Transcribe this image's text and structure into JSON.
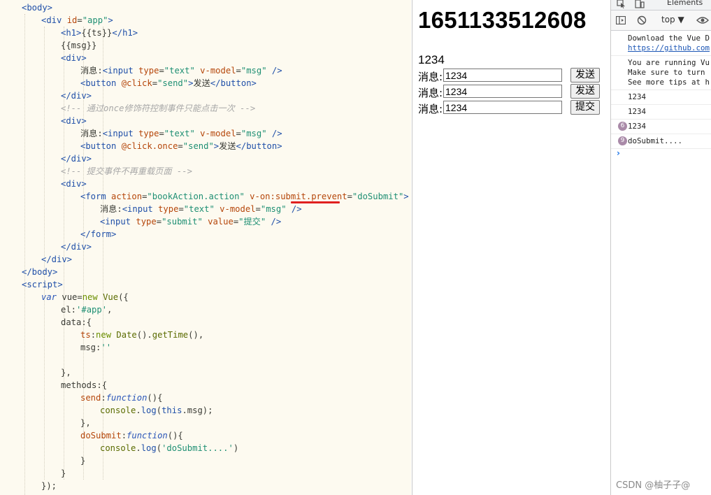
{
  "editor": {
    "lines": [
      {
        "indent": 1,
        "parts": [
          [
            "tag",
            "<body>"
          ]
        ]
      },
      {
        "indent": 2,
        "parts": [
          [
            "tag",
            "<div "
          ],
          [
            "attr",
            "id"
          ],
          [
            "punct",
            "="
          ],
          [
            "val",
            "\"app\""
          ],
          [
            "tag",
            ">"
          ]
        ]
      },
      {
        "indent": 3,
        "parts": [
          [
            "tag",
            "<h1>"
          ],
          [
            "txt",
            "{{ts}}"
          ],
          [
            "tag",
            "</h1>"
          ]
        ]
      },
      {
        "indent": 3,
        "parts": [
          [
            "txt",
            "{{msg}}"
          ]
        ]
      },
      {
        "indent": 3,
        "parts": [
          [
            "tag",
            "<div>"
          ]
        ]
      },
      {
        "indent": 4,
        "parts": [
          [
            "txt",
            "消息:"
          ],
          [
            "tag",
            "<input "
          ],
          [
            "attr",
            "type"
          ],
          [
            "punct",
            "="
          ],
          [
            "val",
            "\"text\""
          ],
          [
            "attr",
            " v-model"
          ],
          [
            "punct",
            "="
          ],
          [
            "val",
            "\"msg\""
          ],
          [
            "tag",
            " />"
          ]
        ]
      },
      {
        "indent": 4,
        "parts": [
          [
            "tag",
            "<button "
          ],
          [
            "attr",
            "@click"
          ],
          [
            "punct",
            "="
          ],
          [
            "val",
            "\"send\""
          ],
          [
            "tag",
            ">"
          ],
          [
            "txt",
            "发送"
          ],
          [
            "tag",
            "</button>"
          ]
        ]
      },
      {
        "indent": 3,
        "parts": [
          [
            "tag",
            "</div>"
          ]
        ]
      },
      {
        "indent": 3,
        "parts": [
          [
            "cmt",
            "<!-- 通过once修饰符控制事件只能点击一次 -->"
          ]
        ]
      },
      {
        "indent": 3,
        "parts": [
          [
            "tag",
            "<div>"
          ]
        ]
      },
      {
        "indent": 4,
        "parts": [
          [
            "txt",
            "消息:"
          ],
          [
            "tag",
            "<input "
          ],
          [
            "attr",
            "type"
          ],
          [
            "punct",
            "="
          ],
          [
            "val",
            "\"text\""
          ],
          [
            "attr",
            " v-model"
          ],
          [
            "punct",
            "="
          ],
          [
            "val",
            "\"msg\""
          ],
          [
            "tag",
            " />"
          ]
        ]
      },
      {
        "indent": 4,
        "parts": [
          [
            "tag",
            "<button "
          ],
          [
            "attr",
            "@click.once"
          ],
          [
            "punct",
            "="
          ],
          [
            "val",
            "\"send\""
          ],
          [
            "tag",
            ">"
          ],
          [
            "txt",
            "发送"
          ],
          [
            "tag",
            "</button>"
          ]
        ]
      },
      {
        "indent": 3,
        "parts": [
          [
            "tag",
            "</div>"
          ]
        ]
      },
      {
        "indent": 3,
        "parts": [
          [
            "cmt",
            "<!-- 提交事件不再重载页面 -->"
          ]
        ]
      },
      {
        "indent": 3,
        "parts": [
          [
            "tag",
            "<div>"
          ]
        ]
      },
      {
        "indent": 4,
        "parts": [
          [
            "tag",
            "<form "
          ],
          [
            "attr",
            "action"
          ],
          [
            "punct",
            "="
          ],
          [
            "val",
            "\"bookAction.action\""
          ],
          [
            "attr",
            " v-on:submit.prevent"
          ],
          [
            "punct",
            "="
          ],
          [
            "val",
            "\"doSubmit\""
          ],
          [
            "tag",
            ">"
          ]
        ]
      },
      {
        "indent": 5,
        "parts": [
          [
            "txt",
            "消息:"
          ],
          [
            "tag",
            "<input "
          ],
          [
            "attr",
            "type"
          ],
          [
            "punct",
            "="
          ],
          [
            "val",
            "\"text\""
          ],
          [
            "attr",
            " v-model"
          ],
          [
            "punct",
            "="
          ],
          [
            "val",
            "\"msg\""
          ],
          [
            "tag",
            " />"
          ]
        ]
      },
      {
        "indent": 5,
        "parts": [
          [
            "tag",
            "<input "
          ],
          [
            "attr",
            "type"
          ],
          [
            "punct",
            "="
          ],
          [
            "val",
            "\"submit\""
          ],
          [
            "attr",
            " value"
          ],
          [
            "punct",
            "="
          ],
          [
            "val",
            "\"提交\""
          ],
          [
            "tag",
            " />"
          ]
        ]
      },
      {
        "indent": 4,
        "parts": [
          [
            "tag",
            "</form>"
          ]
        ]
      },
      {
        "indent": 3,
        "parts": [
          [
            "tag",
            "</div>"
          ]
        ]
      },
      {
        "indent": 2,
        "parts": [
          [
            "tag",
            "</div>"
          ]
        ]
      },
      {
        "indent": 1,
        "parts": [
          [
            "tag",
            "</body>"
          ]
        ]
      },
      {
        "indent": 1,
        "parts": [
          [
            "tag",
            "<script>"
          ]
        ]
      },
      {
        "indent": 2,
        "parts": [
          [
            "kw",
            "var "
          ],
          [
            "txt",
            "vue="
          ],
          [
            "newkw",
            "new "
          ],
          [
            "call",
            "Vue"
          ],
          [
            "txt",
            "({"
          ]
        ]
      },
      {
        "indent": 3,
        "parts": [
          [
            "txt",
            "el:"
          ],
          [
            "str",
            "'#app'"
          ],
          [
            "txt",
            ","
          ]
        ]
      },
      {
        "indent": 3,
        "parts": [
          [
            "txt",
            "data:{"
          ]
        ]
      },
      {
        "indent": 4,
        "parts": [
          [
            "prop",
            "ts"
          ],
          [
            "txt",
            ":"
          ],
          [
            "newkw",
            "new "
          ],
          [
            "call",
            "Date"
          ],
          [
            "txt",
            "()."
          ],
          [
            "call",
            "getTime"
          ],
          [
            "txt",
            "(),"
          ]
        ]
      },
      {
        "indent": 4,
        "parts": [
          [
            "txt",
            "msg:"
          ],
          [
            "str",
            "''"
          ]
        ]
      },
      {
        "indent": 4,
        "parts": []
      },
      {
        "indent": 3,
        "parts": [
          [
            "txt",
            "},"
          ]
        ]
      },
      {
        "indent": 3,
        "parts": [
          [
            "txt",
            "methods:{"
          ]
        ]
      },
      {
        "indent": 4,
        "parts": [
          [
            "prop",
            "send"
          ],
          [
            "txt",
            ":"
          ],
          [
            "kw",
            "function"
          ],
          [
            "txt",
            "(){"
          ]
        ]
      },
      {
        "indent": 5,
        "parts": [
          [
            "call",
            "console"
          ],
          [
            "txt",
            "."
          ],
          [
            "fn",
            "log"
          ],
          [
            "txt",
            "("
          ],
          [
            "fn",
            "this"
          ],
          [
            "txt",
            ".msg);"
          ]
        ]
      },
      {
        "indent": 4,
        "parts": [
          [
            "txt",
            "},"
          ]
        ]
      },
      {
        "indent": 4,
        "parts": [
          [
            "prop",
            "doSubmit"
          ],
          [
            "txt",
            ":"
          ],
          [
            "kw",
            "function"
          ],
          [
            "txt",
            "(){"
          ]
        ]
      },
      {
        "indent": 5,
        "parts": [
          [
            "call",
            "console"
          ],
          [
            "txt",
            "."
          ],
          [
            "fn",
            "log"
          ],
          [
            "txt",
            "("
          ],
          [
            "str",
            "'doSubmit....'"
          ],
          [
            "txt",
            ")"
          ]
        ]
      },
      {
        "indent": 4,
        "parts": [
          [
            "txt",
            "}"
          ]
        ]
      },
      {
        "indent": 3,
        "parts": [
          [
            "txt",
            "}"
          ]
        ]
      },
      {
        "indent": 2,
        "parts": [
          [
            "txt",
            "});"
          ]
        ]
      }
    ]
  },
  "page": {
    "ts": "1651133512608",
    "msg": "1234",
    "rows": [
      {
        "label": "消息:",
        "value": "1234",
        "button": "发送"
      },
      {
        "label": "消息:",
        "value": "1234",
        "button": "发送"
      },
      {
        "label": "消息:",
        "value": "1234",
        "button": "提交"
      }
    ]
  },
  "devtools": {
    "tab_elements": "Elements",
    "context": "top ▼",
    "logs": [
      {
        "lines": [
          "Download the Vue D",
          "https://github.com"
        ],
        "link_line": 1
      },
      {
        "lines": [
          "You are running Vu",
          "Make sure to turn",
          "See more tips at h"
        ]
      },
      {
        "lines": [
          "1234"
        ]
      },
      {
        "lines": [
          "1234"
        ]
      },
      {
        "lines": [
          "1234"
        ],
        "count": "6"
      },
      {
        "lines": [
          "doSubmit...."
        ],
        "count": "9"
      }
    ],
    "prompt": "›"
  },
  "watermark": "CSDN @柚子子@"
}
